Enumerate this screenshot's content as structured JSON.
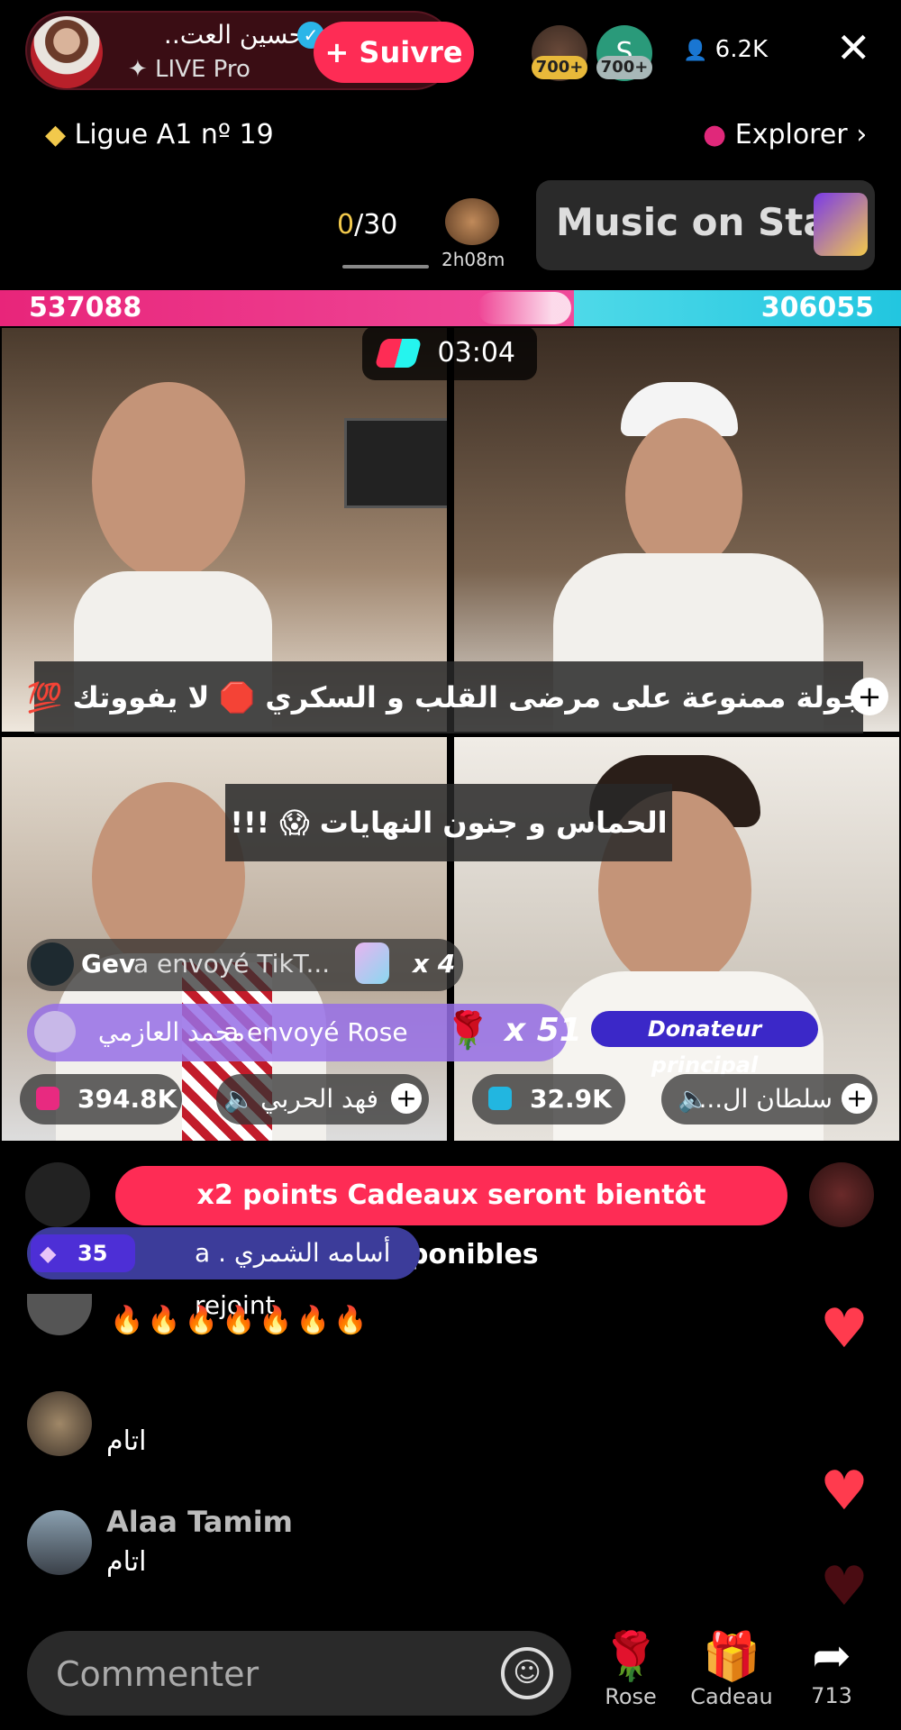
{
  "header": {
    "host_name": "حسين العت..",
    "host_subtitle": "✦ LIVE Pro",
    "follow_label": "+ Suivre",
    "top_viewers": [
      {
        "badge": "700+",
        "initial": ""
      },
      {
        "badge": "700+",
        "initial": "S"
      }
    ],
    "viewer_count": "6.2K",
    "close_glyph": "✕"
  },
  "league": {
    "label": "Ligue A1 nº 19",
    "explore_label": "Explorer"
  },
  "challenge": {
    "progress_current": "0",
    "progress_total": "/30",
    "timer": "2h08m",
    "music_label": "Music on Sta"
  },
  "battle": {
    "score_left": "537088",
    "score_right": "306055",
    "left_share": 0.637,
    "countdown": "03:04",
    "banner_top": "جولة ممنوعة على مرضى القلب و السكري 🛑 لا يفووتك 💯",
    "banner_middle": "الحماس و جنون النهايات 😱 !!!"
  },
  "gifts": [
    {
      "sender": "Gev",
      "action": "a envoyé  TikT...",
      "count": "x 4",
      "icon": "tiktok-gift-icon"
    },
    {
      "sender": "محمد العازمي",
      "action": "a envoyé  Rose",
      "count": "x 51",
      "icon": "rose-icon"
    }
  ],
  "donor_badge": "Donateur principal",
  "participants": [
    {
      "score": "394.8K",
      "name": "فهد الحربي"
    },
    {
      "score": "32.9K",
      "name": "سلطان ال..."
    }
  ],
  "notice": "x2 points Cadeaux seront bientôt disponibles",
  "join": {
    "level": "35",
    "text": "أسامه الشمري . a rejoint"
  },
  "chat": [
    {
      "name": "",
      "text": "🔥🔥🔥🔥🔥🔥🔥"
    },
    {
      "name": "",
      "text": "اتام"
    },
    {
      "name": "Alaa Tamim",
      "text": "اتام"
    }
  ],
  "bottom": {
    "comment_placeholder": "Commenter",
    "actions": [
      {
        "label": "Rose",
        "icon": "🌹"
      },
      {
        "label": "Cadeau",
        "icon": "🎁"
      },
      {
        "label": "713",
        "icon": "➦"
      }
    ]
  }
}
